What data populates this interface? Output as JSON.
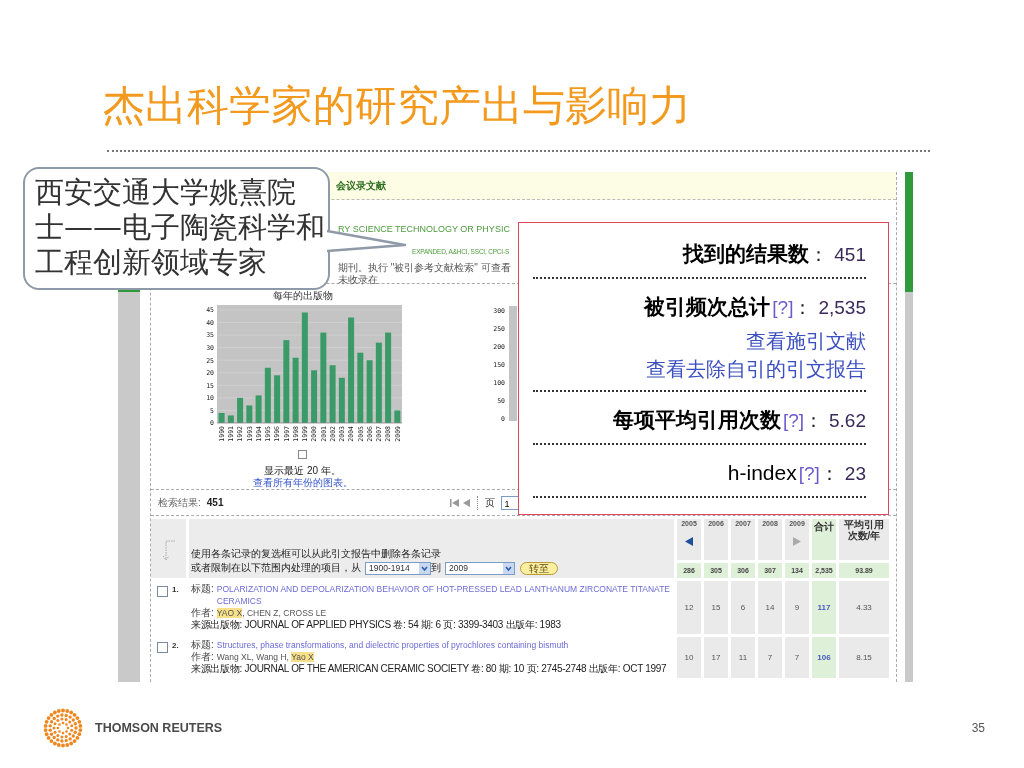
{
  "slide": {
    "title": "杰出科学家的研究产出与影响力",
    "footer_brand": "THOMSON REUTERS",
    "page_number": "35"
  },
  "callout": {
    "text_lines": [
      "西安交通大学姚熹院",
      "士——电子陶瓷科学和",
      "工程创新领域专家"
    ]
  },
  "screenshot": {
    "header_band": "会议录文献",
    "query_lines": [
      {
        "kind": "topic",
        "text": "RY SCIENCE TECHNOLOGY OR PHYSIC"
      },
      {
        "kind": "databases",
        "text": "EXPANDED, A&HCI, SSCI, CPCI-S"
      },
      {
        "kind": "note",
        "text": "期刊。执行 \"被引参考文献检索\" 可查看未收录在"
      }
    ],
    "publications_chart": {
      "chart_data": {
        "type": "bar",
        "title": "每年的出版物",
        "categories": [
          "1990",
          "1991",
          "1992",
          "1993",
          "1994",
          "1995",
          "1996",
          "1997",
          "1998",
          "1999",
          "2000",
          "2001",
          "2002",
          "2003",
          "2004",
          "2005",
          "2006",
          "2007",
          "2008",
          "2009"
        ],
        "values": [
          4,
          3,
          10,
          7,
          11,
          22,
          19,
          33,
          26,
          44,
          21,
          36,
          23,
          18,
          42,
          28,
          25,
          32,
          36,
          5
        ],
        "ylim": [
          0,
          45
        ],
        "grid": true,
        "yticks": [
          0,
          5,
          10,
          15,
          20,
          25,
          30,
          35,
          40,
          45
        ]
      }
    },
    "chart_caption": "显示最近 20 年。",
    "chart_link": "查看所有年份的图表。",
    "citations_chart": {
      "ytick_labels": [
        "300",
        "250",
        "200",
        "150",
        "100",
        "50",
        "0"
      ]
    },
    "results": {
      "label": "检索结果:",
      "count": "451",
      "page_label": "页",
      "page_value": "1"
    },
    "report": {
      "instruction": "使用各条记录的复选框可以从此引文报告中删除各条记录",
      "range_label": "或者限制在以下范围内处理的项目，从",
      "range_from": "1900-1914",
      "range_to_label": "到",
      "range_to": "2009",
      "go_button": "转至",
      "author_separator": ", ",
      "columns": [
        {
          "kind": "year",
          "label": "2005",
          "arrow": {
            "points_left": true,
            "disabled": false
          }
        },
        {
          "kind": "year",
          "label": "2006"
        },
        {
          "kind": "year",
          "label": "2007"
        },
        {
          "kind": "year",
          "label": "2008"
        },
        {
          "kind": "year",
          "label": "2009",
          "arrow": {
            "points_left": false,
            "disabled": true
          }
        },
        {
          "kind": "total",
          "label": "合计"
        },
        {
          "kind": "average",
          "label": "平均引用次数/年"
        }
      ],
      "totals": [
        "286",
        "305",
        "306",
        "307",
        "134",
        "2,535",
        "93.89"
      ],
      "records": [
        {
          "number": "1.",
          "checked": false,
          "title_label": "标题:",
          "title": "POLARIZATION AND DEPOLARIZATION BEHAVIOR OF HOT-PRESSED LEAD LANTHANUM ZIRCONATE TITANATE CERAMICS",
          "author_label": "作者:",
          "authors": [
            {
              "name": "YAO X",
              "highlighted": true
            },
            {
              "name": "CHEN Z",
              "highlighted": false
            },
            {
              "name": "CROSS LE",
              "highlighted": false
            }
          ],
          "source": "来源出版物: JOURNAL OF APPLIED PHYSICS  卷: 54  期: 6  页: 3399-3403  出版年: 1983",
          "cells": [
            "12",
            "15",
            "6",
            "14",
            "9",
            "117",
            "4.33"
          ]
        },
        {
          "number": "2.",
          "checked": false,
          "title_label": "标题:",
          "title": "Structures, phase transformations, and dielectric properties of pyrochlores containing bismuth",
          "author_label": "作者:",
          "authors": [
            {
              "name": "Wang XL",
              "highlighted": false
            },
            {
              "name": "Wang H",
              "highlighted": false
            },
            {
              "name": "Yao X",
              "highlighted": true
            }
          ],
          "source": "来源出版物: JOURNAL OF THE AMERICAN CERAMIC SOCIETY  卷: 80  期: 10  页: 2745-2748  出版年: OCT 1997",
          "cells": [
            "10",
            "17",
            "11",
            "7",
            "7",
            "106",
            "8.15"
          ]
        }
      ]
    }
  },
  "metrics_popup": {
    "metrics": [
      {
        "kind": "bold",
        "label": "找到的结果数",
        "separator": "：",
        "value": "451"
      },
      {
        "kind": "bold",
        "label": "被引频次总计",
        "help": "[?]",
        "separator": "：",
        "value": "2,535",
        "links": [
          "查看施引文献",
          "查看去除自引的引文报告"
        ]
      },
      {
        "kind": "bold",
        "label": "每项平均引用次数",
        "help": "[?]",
        "separator": "：",
        "value": "5.62"
      },
      {
        "kind": "plain",
        "label": "h-index",
        "help": "[?]",
        "separator": "：",
        "value": "23"
      }
    ]
  }
}
